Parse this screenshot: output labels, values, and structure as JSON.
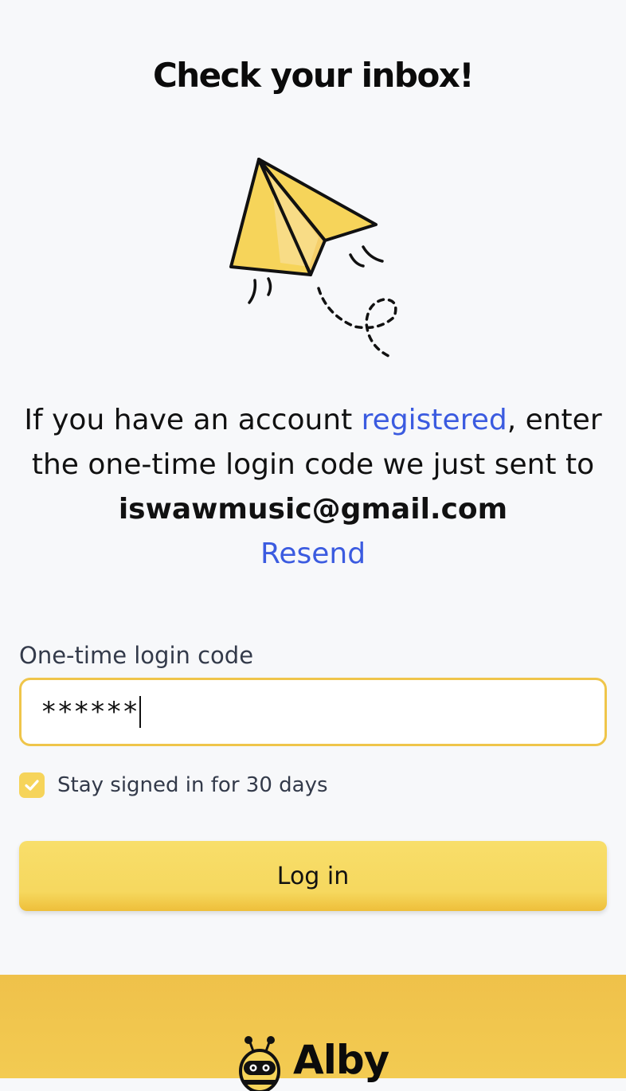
{
  "page": {
    "title": "Check your inbox!"
  },
  "message": {
    "text_before_link": "If you have an account ",
    "link_registered": "registered",
    "text_after_link": ", enter the one-time login code we just sent to ",
    "email": "iswawmusic@gmail.com",
    "resend_label": "Resend"
  },
  "form": {
    "code_label": "One-time login code",
    "code_value": "******",
    "stay_signed_in_label": "Stay signed in for 30 days",
    "stay_signed_in_checked": true,
    "login_button_label": "Log in"
  },
  "footer": {
    "brand_name": "Alby",
    "brand_icon": "alby-bee-icon"
  },
  "colors": {
    "accent_yellow": "#f6d85f",
    "link_blue": "#3b5be0",
    "input_border": "#efc54a",
    "footer_yellow": "#efc14a"
  },
  "icons": {
    "illustration": "paper-plane-icon",
    "checkbox": "check-icon"
  }
}
